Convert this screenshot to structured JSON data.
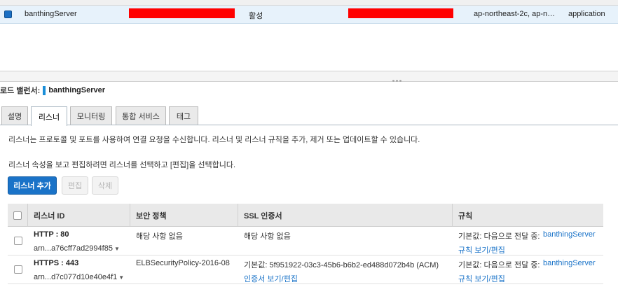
{
  "load_balancer_row": {
    "name": "banthingServer",
    "state": "활성",
    "availability_zones": "ap-northeast-2c, ap-nor...",
    "type": "application",
    "redacted_color": "#ff0000"
  },
  "detail": {
    "label": "로드 밸런서:",
    "name": "banthingServer"
  },
  "tabs": [
    {
      "label": "설명"
    },
    {
      "label": "리스너"
    },
    {
      "label": "모니터링"
    },
    {
      "label": "통합 서비스"
    },
    {
      "label": "태그"
    }
  ],
  "active_tab": "리스너",
  "listener_tab": {
    "description": "리스너는 프로토콜 및 포트를 사용하여 연결 요청을 수신합니다. 리스너 및 리스너 규칙을 추가, 제거 또는 업데이트할 수 있습니다.",
    "instruction": "리스너 속성을 보고 편집하려면 리스너를 선택하고 [편집]을 선택합니다.",
    "buttons": {
      "add": "리스너 추가",
      "edit": "편집",
      "delete": "삭제"
    },
    "columns": {
      "listener_id": "리스너 ID",
      "security_policy": "보안 정책",
      "ssl_cert": "SSL 인증서",
      "rules": "규칙"
    },
    "rows": [
      {
        "protocol": "HTTP : 80",
        "arn": "arn...a76cff7ad2994f85",
        "security_policy": "해당 사항 없음",
        "ssl_cert": "해당 사항 없음",
        "ssl_link": "",
        "rule_prefix": "기본값:  다음으로 전달 중:",
        "rule_target": "banthingServer",
        "rule_link": "규칙 보기/편집"
      },
      {
        "protocol": "HTTPS : 443",
        "arn": "arn...d7c077d10e40e4f1",
        "security_policy": "ELBSecurityPolicy-2016-08",
        "ssl_cert": "기본값:  5f951922-03c3-45b6-b6b2-ed488d072b4b (ACM)",
        "ssl_link": "인증서 보기/편집",
        "rule_prefix": "기본값:  다음으로 전달 중:",
        "rule_target": "banthingServer",
        "rule_link": "규칙 보기/편집"
      }
    ]
  },
  "colors": {
    "accent": "#1a73c8",
    "selected_row": "#e7f2fb"
  }
}
